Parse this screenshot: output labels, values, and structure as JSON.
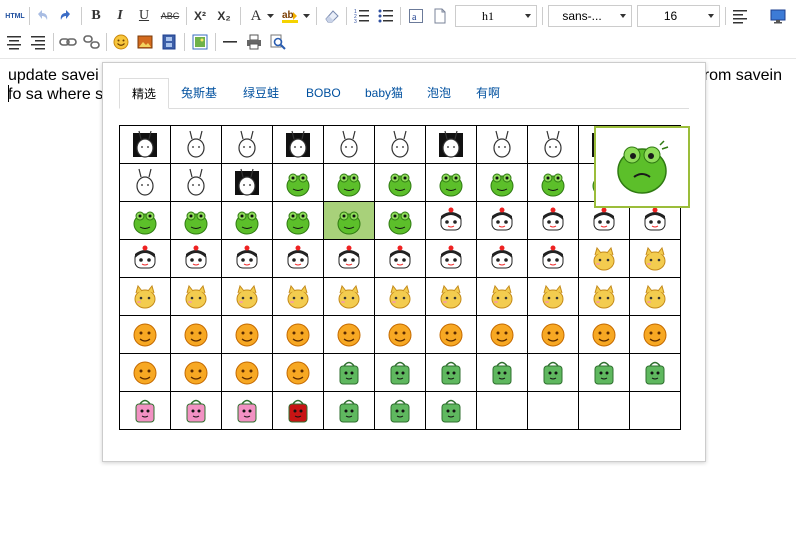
{
  "toolbar": {
    "html_label": "HTML",
    "bold_label": "B",
    "italic_label": "I",
    "underline_label": "U",
    "strike_label": "ABC",
    "sup_label": "X²",
    "sub_label": "X₂",
    "fontcolor_label": "A",
    "paragraph_value": "h1",
    "fontfamily_value": "sans-...",
    "fontsize_value": "16"
  },
  "editor": {
    "line1_left": "update savei",
    "line1_right": "rom savein",
    "line2_left": "fo sa where s"
  },
  "emotion_popup": {
    "tabs": [
      {
        "label": "精选",
        "active": true
      },
      {
        "label": "兔斯基",
        "active": false
      },
      {
        "label": "绿豆蛙",
        "active": false
      },
      {
        "label": "BOBO",
        "active": false
      },
      {
        "label": "baby猫",
        "active": false
      },
      {
        "label": "泡泡",
        "active": false
      },
      {
        "label": "有啊",
        "active": false
      }
    ],
    "rows": [
      [
        "tusiji",
        "tusiji",
        "tusiji",
        "tusiji",
        "tusiji",
        "tusiji",
        "tusiji",
        "tusiji",
        "tusiji",
        "tusiji",
        "tusiji"
      ],
      [
        "tusiji",
        "tusiji",
        "tusiji",
        "frog",
        "frog",
        "frog",
        "frog",
        "frog",
        "frog",
        "frog",
        "frog"
      ],
      [
        "frog",
        "frog",
        "frog",
        "frog",
        "frog",
        "frog",
        "bobo",
        "bobo",
        "bobo",
        "bobo",
        "bobo"
      ],
      [
        "bobo",
        "bobo",
        "bobo",
        "bobo",
        "bobo",
        "bobo",
        "bobo",
        "bobo",
        "bobo",
        "cat",
        "cat"
      ],
      [
        "cat",
        "cat",
        "cat",
        "cat",
        "cat",
        "cat",
        "cat",
        "cat",
        "cat",
        "cat",
        "cat"
      ],
      [
        "bubble",
        "bubble",
        "bubble",
        "bubble",
        "bubble",
        "bubble",
        "bubble",
        "bubble",
        "bubble",
        "bubble",
        "bubble"
      ],
      [
        "bubble",
        "bubble",
        "bubble",
        "bubble",
        "youa",
        "youa",
        "youa",
        "youa",
        "youa",
        "youa",
        "youa"
      ],
      [
        "youa",
        "youa",
        "youa",
        "youa",
        "youa",
        "youa",
        "youa",
        "",
        "",
        "",
        ""
      ]
    ],
    "highlight": [
      2,
      4
    ],
    "preview_icon": "frog-icon",
    "colors": {
      "tusiji": "#333333",
      "frog": "#5cbf2a",
      "bobo": "#222222",
      "cat": "#f3cc4f",
      "bubble": "#f7a823",
      "youa": "#5fb85f",
      "youa_pink": "#f291c3",
      "highlight": "#a8d17a",
      "preview_border": "#9bbd3a",
      "tab_link": "#00509f"
    }
  }
}
